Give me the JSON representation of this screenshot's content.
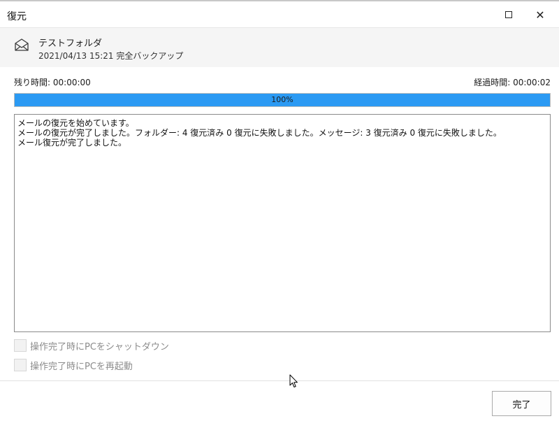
{
  "window": {
    "title": "復元",
    "maximize_icon": "maximize-icon",
    "close_icon": "close-icon"
  },
  "header": {
    "icon": "mail-envelope-icon",
    "folder_name": "テストフォルダ",
    "backup_info": "2021/04/13 15:21 完全バックアップ"
  },
  "status": {
    "remaining_label": "残り時間:",
    "remaining_value": "00:00:00",
    "elapsed_label": "経過時間:",
    "elapsed_value": "00:00:02"
  },
  "progress": {
    "percent": 100,
    "label": "100%",
    "color": "#2b9af3"
  },
  "log": {
    "lines": [
      "メールの復元を始めています。",
      "メールの復元が完了しました。フォルダー: 4 復元済み 0 復元に失敗しました。メッセージ: 3 復元済み 0 復元に失敗しました。",
      "メール復元が完了しました。"
    ]
  },
  "options": [
    {
      "label": "操作完了時にPCをシャットダウン",
      "checked": false,
      "disabled": true
    },
    {
      "label": "操作完了時にPCを再起動",
      "checked": false,
      "disabled": true
    }
  ],
  "footer": {
    "done_label": "完了"
  }
}
